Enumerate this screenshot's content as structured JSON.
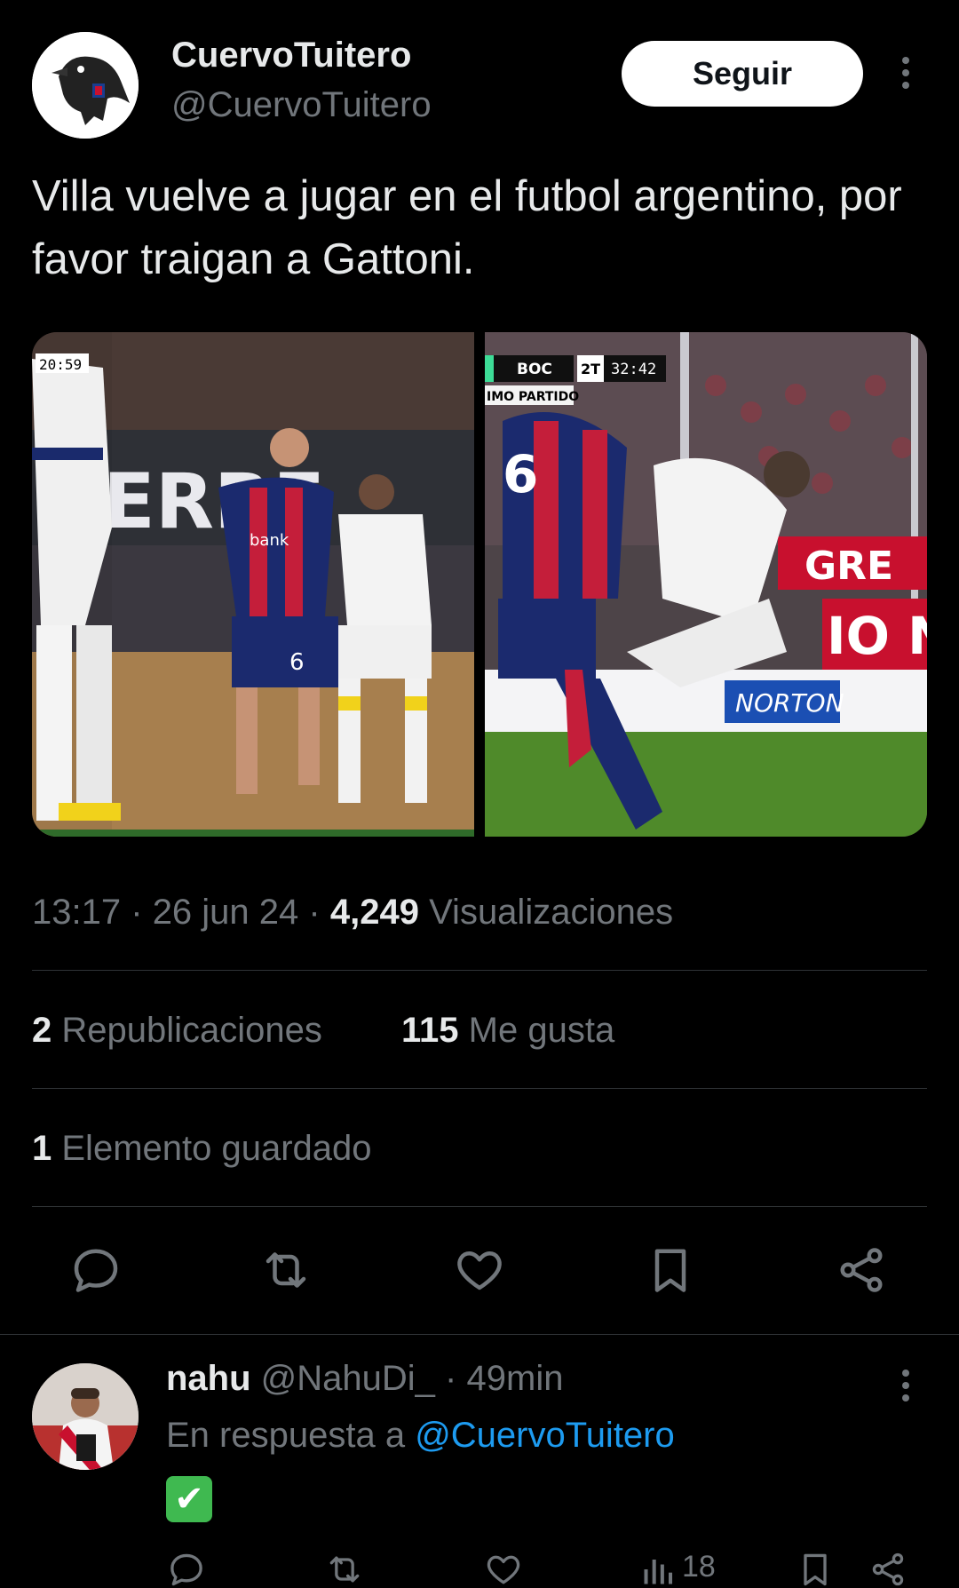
{
  "author": {
    "display_name": "CuervoTuitero",
    "handle": "@CuervoTuitero",
    "follow_label": "Seguir"
  },
  "tweet": {
    "text": "Villa vuelve a jugar en el futbol argentino, por favor traigan a Gattoni.",
    "time": "13:17",
    "date": "26 jun 24",
    "views": "4,249",
    "views_label": "Visualizaciones",
    "separator": "·"
  },
  "media": {
    "left": {
      "timer": "20:59",
      "sponsor": "ERRE",
      "jersey_number": "6",
      "sponsor_text": "bank"
    },
    "right": {
      "team": "BOC",
      "half": "2T",
      "clock": "32:42",
      "caption": "IMO PARTIDO",
      "jersey_number": "6",
      "ad": "NORTON",
      "banner": "GRE",
      "banner2": "IO N"
    }
  },
  "stats": {
    "reposts_count": "2",
    "reposts_label": "Republicaciones",
    "likes_count": "115",
    "likes_label": "Me gusta",
    "saves_count": "1",
    "saves_label": "Elemento guardado"
  },
  "actions": [
    "reply-icon",
    "repost-icon",
    "like-icon",
    "bookmark-icon",
    "share-icon"
  ],
  "reply": {
    "name": "nahu",
    "handle": "@NahuDi_",
    "separator": "·",
    "time": "49min",
    "reply_prefix": "En respuesta a",
    "reply_mention": "@CuervoTuitero",
    "content": "✔",
    "views": "18"
  },
  "colors": {
    "background": "#000000",
    "text": "#e7e9ea",
    "secondary": "#71767b",
    "link": "#1d9bf0",
    "divider": "#2f3336"
  }
}
